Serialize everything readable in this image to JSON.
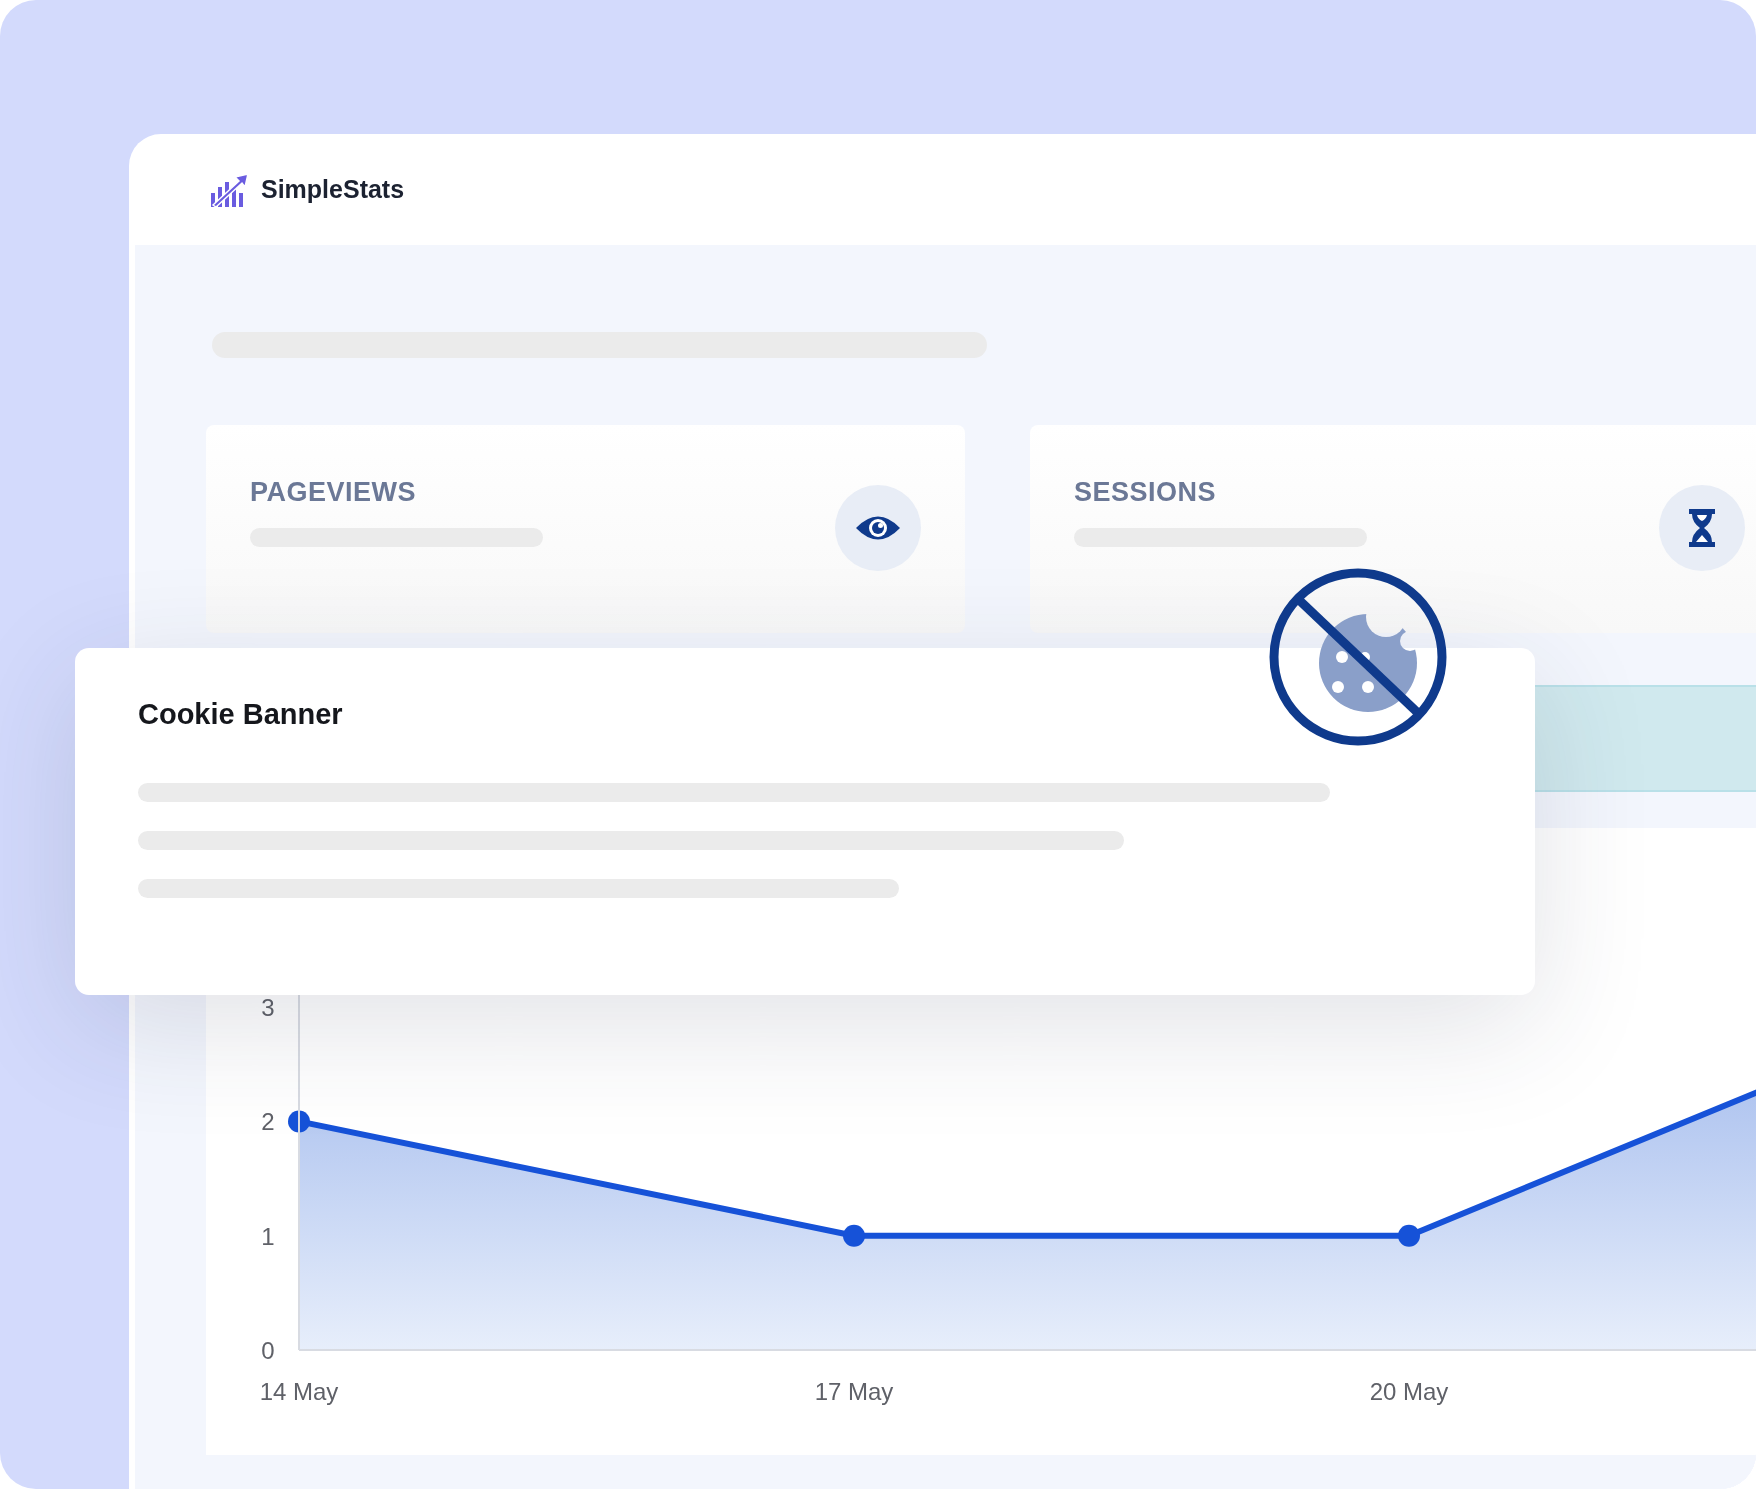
{
  "app": {
    "name": "SimpleStats"
  },
  "stat_cards": [
    {
      "label": "PAGEVIEWS"
    },
    {
      "label": "SESSIONS"
    }
  ],
  "cookie_banner": {
    "title": "Cookie Banner"
  },
  "chart": {
    "chart_data": {
      "type": "area",
      "categories": [
        "14 May",
        "17 May",
        "20 May",
        null
      ],
      "values": [
        2,
        1,
        1,
        3
      ],
      "ylim": [
        0,
        3.5
      ],
      "yticks": [
        0,
        1,
        2,
        3
      ]
    }
  }
}
